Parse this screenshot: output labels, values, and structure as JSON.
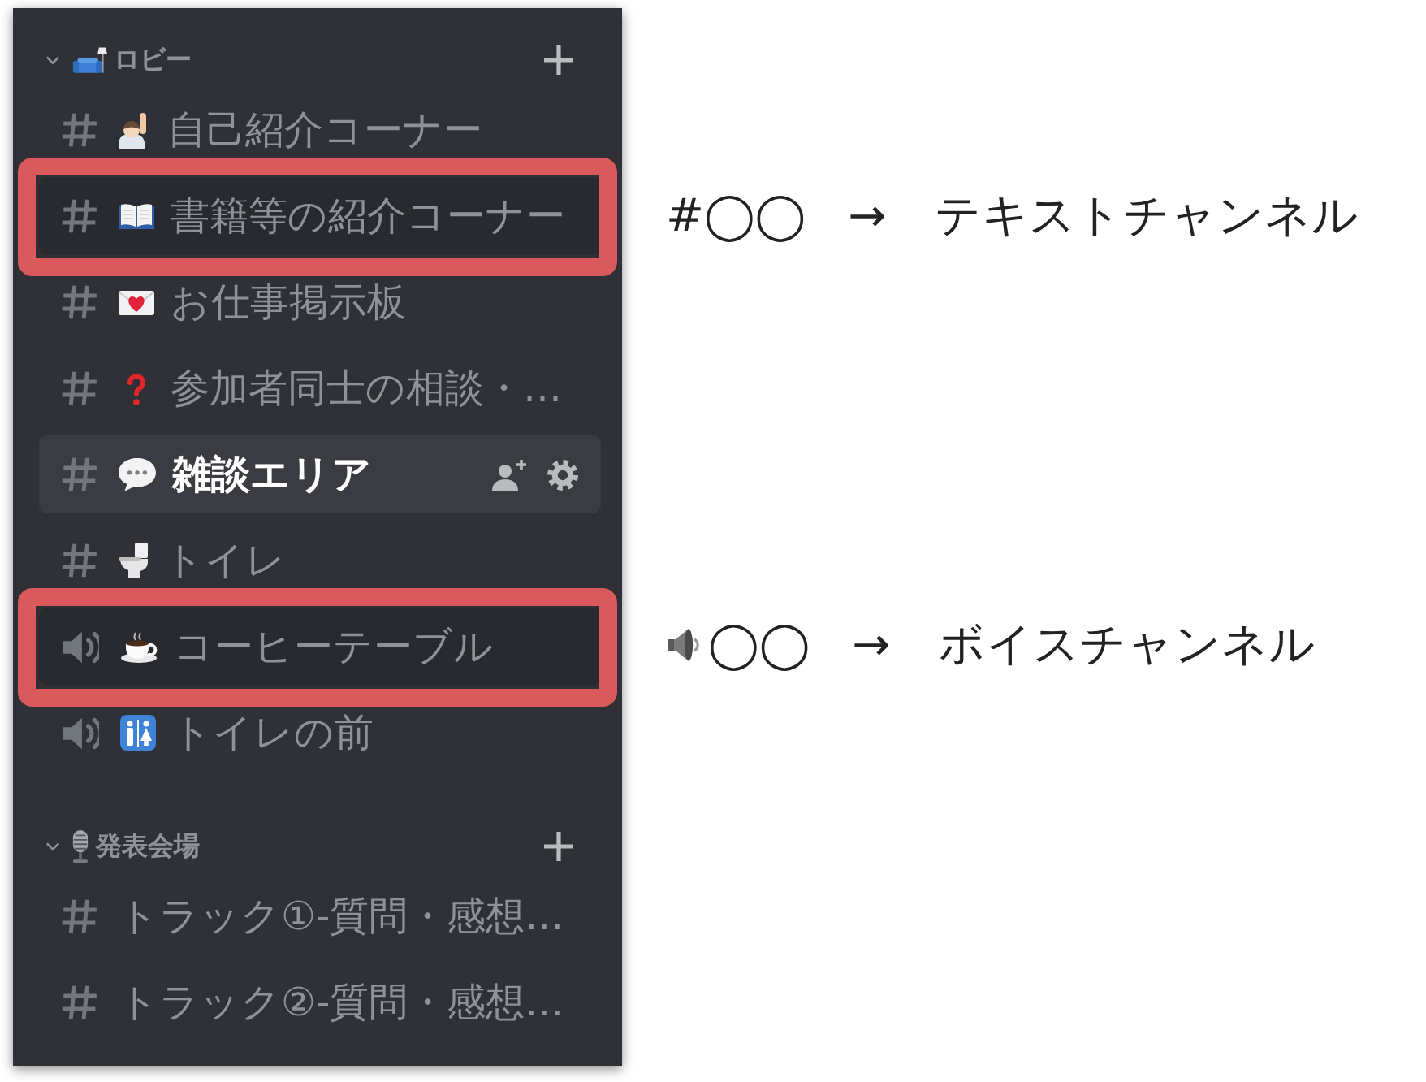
{
  "categories": [
    {
      "name": "ロビー",
      "expanded": true,
      "channels": [
        {
          "kind": "text",
          "name": "自己紹介コーナー",
          "selected": false,
          "highlighted": false
        },
        {
          "kind": "text",
          "name": "書籍等の紹介コーナー",
          "selected": false,
          "highlighted": true
        },
        {
          "kind": "text",
          "name": "お仕事掲示板",
          "selected": false,
          "highlighted": false
        },
        {
          "kind": "text",
          "name": "参加者同士の相談・…",
          "selected": false,
          "highlighted": false
        },
        {
          "kind": "text",
          "name": "雑談エリア",
          "selected": true,
          "highlighted": false
        },
        {
          "kind": "text",
          "name": "トイレ",
          "selected": false,
          "highlighted": false
        },
        {
          "kind": "voice",
          "name": "コーヒーテーブル",
          "selected": false,
          "highlighted": true
        },
        {
          "kind": "voice",
          "name": "トイレの前",
          "selected": false,
          "highlighted": false
        }
      ]
    },
    {
      "name": "発表会場",
      "expanded": true,
      "channels": [
        {
          "kind": "text",
          "name": "トラック①-質問・感想…",
          "selected": false,
          "highlighted": false
        },
        {
          "kind": "text",
          "name": "トラック②-質問・感想…",
          "selected": false,
          "highlighted": false
        }
      ]
    }
  ],
  "legend": [
    {
      "kind": "text",
      "term": "#◯◯",
      "arrow": "→",
      "meaning": "テキストチャンネル"
    },
    {
      "kind": "voice",
      "term": "◯◯",
      "arrow": "→",
      "meaning": "ボイスチャンネル"
    }
  ]
}
